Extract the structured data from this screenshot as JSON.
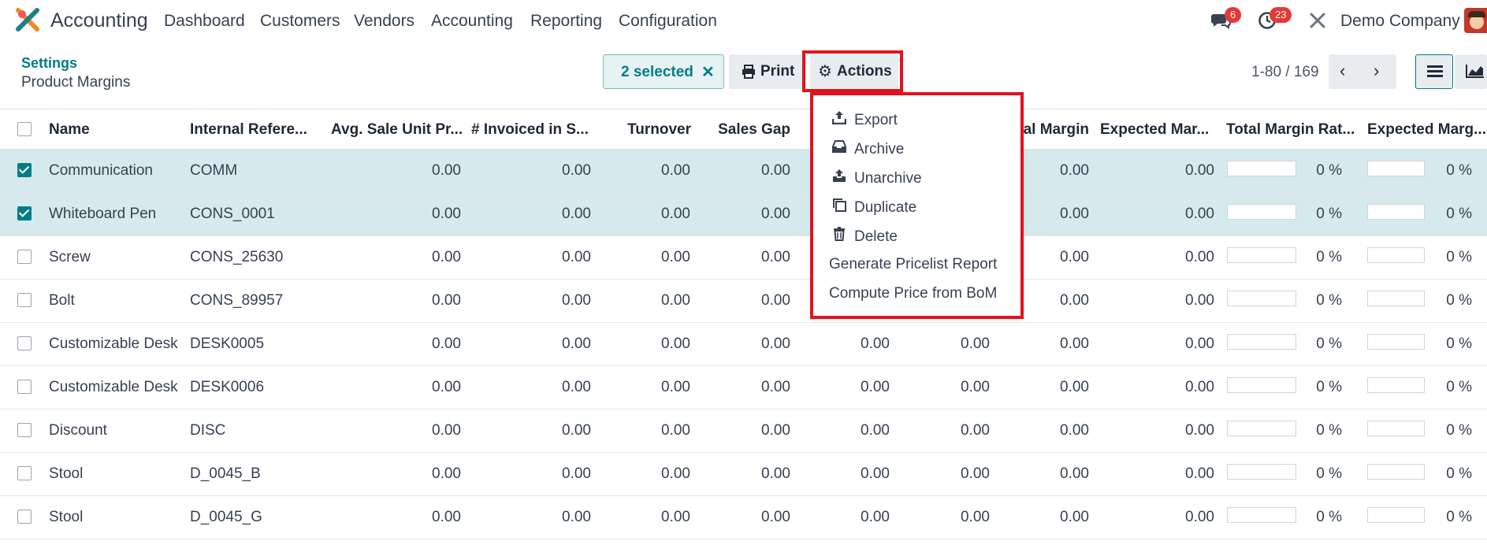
{
  "app": {
    "name": "Accounting"
  },
  "nav": {
    "menu": [
      "Dashboard",
      "Customers",
      "Vendors",
      "Accounting",
      "Reporting",
      "Configuration"
    ],
    "messages_count": "6",
    "activities_count": "23",
    "company": "Demo Company"
  },
  "control": {
    "breadcrumb": "Settings",
    "title": "Product Margins",
    "selected_label": "2 selected",
    "print_label": "Print",
    "actions_label": "Actions",
    "pager": "1-80 / 169"
  },
  "actions_menu": [
    {
      "label": "Export",
      "icon": "upload-icon"
    },
    {
      "label": "Archive",
      "icon": "archive-icon"
    },
    {
      "label": "Unarchive",
      "icon": "unarchive-icon"
    },
    {
      "label": "Duplicate",
      "icon": "copy-icon"
    },
    {
      "label": "Delete",
      "icon": "trash-icon"
    },
    {
      "label": "Generate Pricelist Report",
      "icon": ""
    },
    {
      "label": "Compute Price from BoM",
      "icon": ""
    }
  ],
  "table": {
    "headers": [
      "Name",
      "Internal Refere...",
      "Avg. Sale Unit Pr...",
      "# Invoiced in S...",
      "Turnover",
      "Sales Gap",
      "al Margin",
      "Expected Mar...",
      "Total Margin Rat...",
      "Expected Marg..."
    ],
    "rows": [
      {
        "selected": true,
        "name": "Communication",
        "ref": "COMM",
        "v": [
          "0.00",
          "0.00",
          "0.00",
          "0.00",
          "",
          "",
          "0.00",
          "0.00"
        ],
        "rate1": "0 %",
        "rate2": "0 %"
      },
      {
        "selected": true,
        "name": "Whiteboard Pen",
        "ref": "CONS_0001",
        "v": [
          "0.00",
          "0.00",
          "0.00",
          "0.00",
          "",
          "",
          "0.00",
          "0.00"
        ],
        "rate1": "0 %",
        "rate2": "0 %"
      },
      {
        "selected": false,
        "name": "Screw",
        "ref": "CONS_25630",
        "v": [
          "0.00",
          "0.00",
          "0.00",
          "0.00",
          "",
          "",
          "0.00",
          "0.00"
        ],
        "rate1": "0 %",
        "rate2": "0 %"
      },
      {
        "selected": false,
        "name": "Bolt",
        "ref": "CONS_89957",
        "v": [
          "0.00",
          "0.00",
          "0.00",
          "0.00",
          "",
          "",
          "0.00",
          "0.00"
        ],
        "rate1": "0 %",
        "rate2": "0 %"
      },
      {
        "selected": false,
        "name": "Customizable Desk",
        "ref": "DESK0005",
        "v": [
          "0.00",
          "0.00",
          "0.00",
          "0.00",
          "0.00",
          "0.00",
          "0.00",
          "0.00"
        ],
        "rate1": "0 %",
        "rate2": "0 %"
      },
      {
        "selected": false,
        "name": "Customizable Desk",
        "ref": "DESK0006",
        "v": [
          "0.00",
          "0.00",
          "0.00",
          "0.00",
          "0.00",
          "0.00",
          "0.00",
          "0.00"
        ],
        "rate1": "0 %",
        "rate2": "0 %"
      },
      {
        "selected": false,
        "name": "Discount",
        "ref": "DISC",
        "v": [
          "0.00",
          "0.00",
          "0.00",
          "0.00",
          "0.00",
          "0.00",
          "0.00",
          "0.00"
        ],
        "rate1": "0 %",
        "rate2": "0 %"
      },
      {
        "selected": false,
        "name": "Stool",
        "ref": "D_0045_B",
        "v": [
          "0.00",
          "0.00",
          "0.00",
          "0.00",
          "0.00",
          "0.00",
          "0.00",
          "0.00"
        ],
        "rate1": "0 %",
        "rate2": "0 %"
      },
      {
        "selected": false,
        "name": "Stool",
        "ref": "D_0045_G",
        "v": [
          "0.00",
          "0.00",
          "0.00",
          "0.00",
          "0.00",
          "0.00",
          "0.00",
          "0.00"
        ],
        "rate1": "0 %",
        "rate2": "0 %"
      }
    ]
  },
  "colors": {
    "accent": "#017e84",
    "highlight": "#e3121d",
    "selected_row": "#d6eaed",
    "badge": "#e53935"
  }
}
